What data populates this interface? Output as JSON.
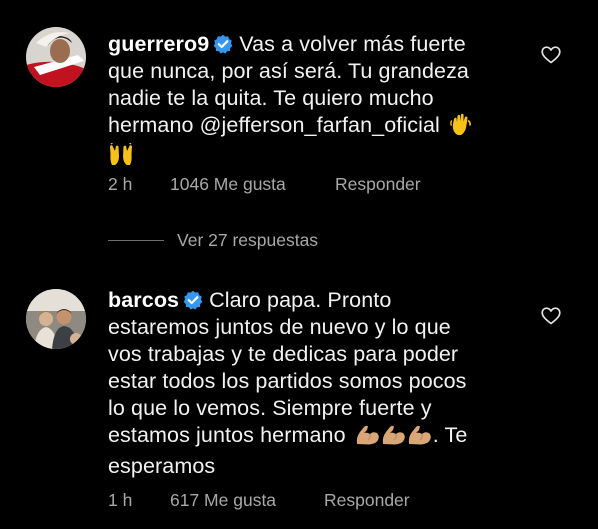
{
  "comments": [
    {
      "username": "guerrero9",
      "verified": true,
      "text_lines": [
        "Vas a volver más fuerte",
        "que nunca, por así será. Tu grandeza",
        "nadie te la quita. Te quiero mucho",
        "hermano @jefferson_farfan_oficial"
      ],
      "emojis": [
        "waving-hand",
        "raising-hands"
      ],
      "time": "2 h",
      "likes": "1046 Me gusta",
      "reply_label": "Responder",
      "view_replies": "Ver 27 respuestas"
    },
    {
      "username": "barcos",
      "verified": true,
      "text_lines": [
        "Claro papa. Pronto",
        "estaremos juntos de nuevo y lo que",
        "vos trabajas y te dedicas para poder",
        "estar todos los partidos somos pocos",
        "lo que lo vemos. Siempre fuerte y",
        "estamos juntos hermano",
        ". Te",
        "esperamos"
      ],
      "emojis": [
        "flexed-biceps",
        "flexed-biceps",
        "flexed-biceps"
      ],
      "time": "1 h",
      "likes": "617 Me gusta",
      "reply_label": "Responder"
    }
  ],
  "colors": {
    "background": "#000000",
    "text": "#f2f2f2",
    "meta": "#a8a8a8",
    "verified_badge": "#3797f0",
    "emoji_yellow": "#f6c21a",
    "emoji_skin": "#d9a777"
  }
}
